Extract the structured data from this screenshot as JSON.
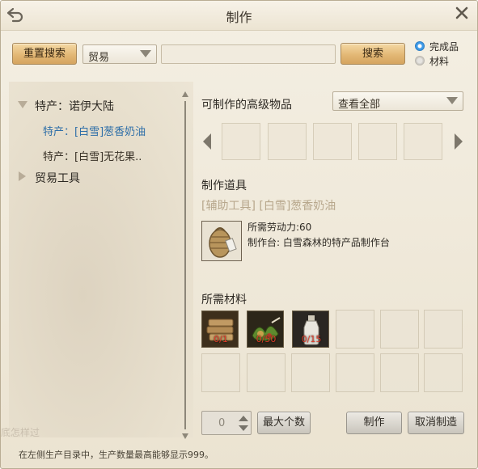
{
  "window": {
    "title": "制作"
  },
  "toolbar": {
    "reset_label": "重置搜索",
    "category_value": "贸易",
    "search_value": "",
    "search_label": "搜索",
    "radio_done": "完成品",
    "radio_material": "材料"
  },
  "tree": [
    {
      "label": "特产：诺伊大陆",
      "expanded": true
    },
    {
      "label": "特产：[白雪]葱香奶油",
      "selected": true
    },
    {
      "label": "特产：[白雪]无花果.."
    },
    {
      "label": "贸易工具",
      "expanded": false
    }
  ],
  "advanced": {
    "title": "可制作的高级物品",
    "filter_value": "查看全部"
  },
  "tool": {
    "section_title": "制作道具",
    "item_name": "[辅助工具] [白雪]葱香奶油",
    "labor": "所需劳动力:60",
    "station": "制作台: 白雪森林的特产品制作台"
  },
  "materials": {
    "title": "所需材料",
    "items": [
      {
        "icon": "wood-bundle-icon",
        "count": "0/1"
      },
      {
        "icon": "herb-bundle-icon",
        "count": "0/50"
      },
      {
        "icon": "milk-bottle-icon",
        "count": "0/15"
      }
    ]
  },
  "bottom": {
    "quantity": "0",
    "max_label": "最大个数",
    "craft_label": "制作",
    "cancel_label": "取消制造",
    "hint": "在左侧生产目录中，生产数量最高能够显示999。",
    "watermark": "底怎样过"
  },
  "colors": {
    "accent_blue": "#3f9be8",
    "selected_text": "#2f6fa8",
    "count_red": "#e23c2a"
  }
}
